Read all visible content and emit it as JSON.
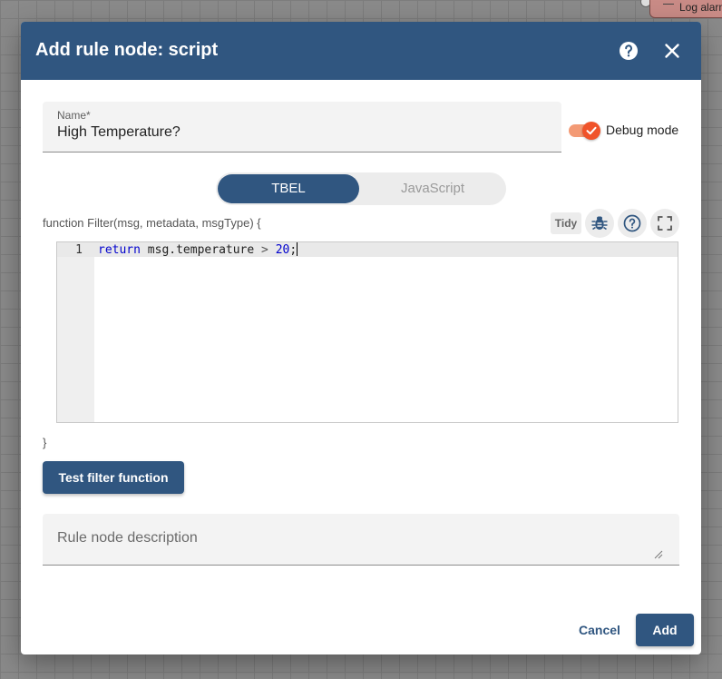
{
  "background": {
    "node_label": "Log alarm"
  },
  "dialog": {
    "title": "Add rule node: script",
    "help_icon": "help-circle-icon",
    "close_icon": "close-icon"
  },
  "form": {
    "name_label": "Name*",
    "name_value": "High Temperature?",
    "debug_mode_label": "Debug mode",
    "debug_mode_on": true,
    "language_options": [
      "TBEL",
      "JavaScript"
    ],
    "selected_language": "TBEL",
    "function_signature": "function Filter(msg, metadata, msgType) {",
    "tidy_label": "Tidy",
    "code_line_number": "1",
    "code": {
      "keyword": "return",
      "expr": "msg.temperature",
      "operator": ">",
      "number": "20",
      "terminator": ";"
    },
    "closing_brace": "}",
    "test_button_label": "Test filter function",
    "description_placeholder": "Rule node description"
  },
  "actions": {
    "cancel_label": "Cancel",
    "add_label": "Add"
  },
  "colors": {
    "primary": "#305680",
    "toggle_on": "#f0532a"
  }
}
